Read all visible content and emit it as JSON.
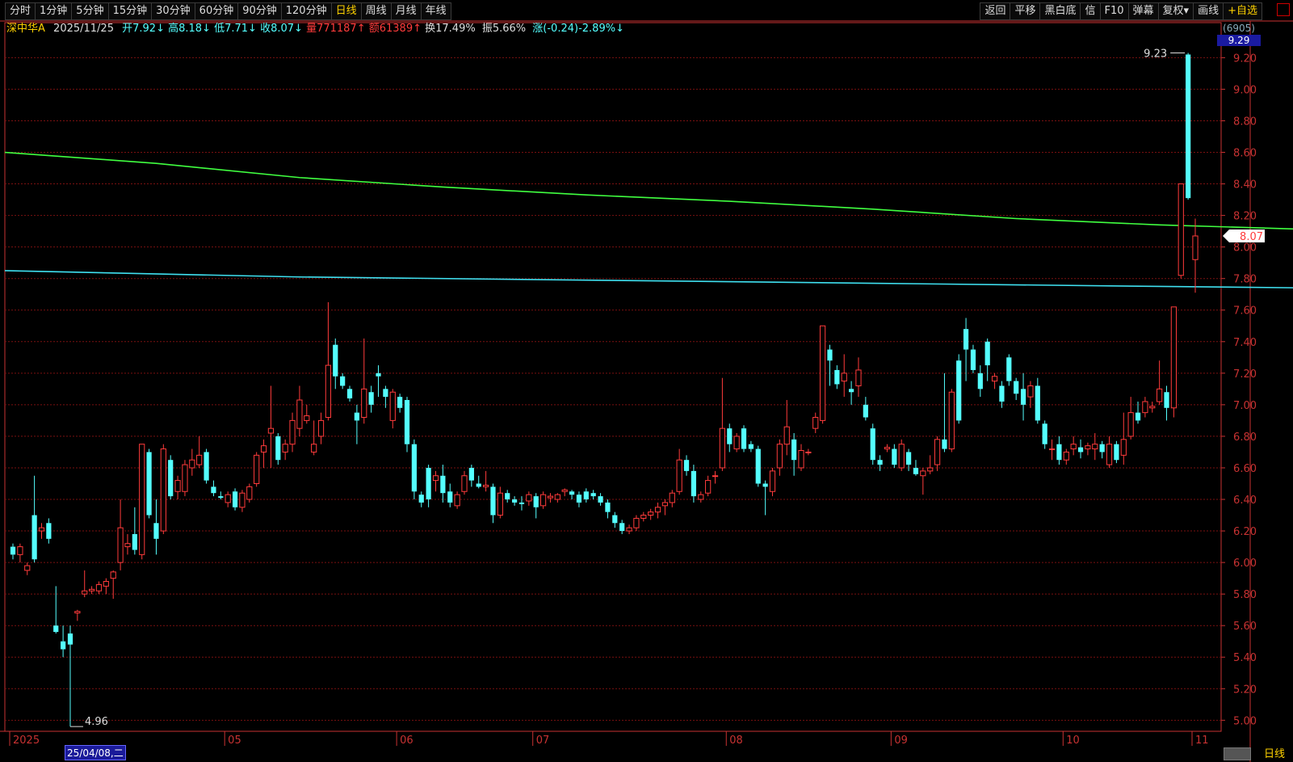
{
  "toolbar": {
    "periods": [
      "分时",
      "1分钟",
      "5分钟",
      "15分钟",
      "30分钟",
      "60分钟",
      "90分钟",
      "120分钟",
      "日线",
      "周线",
      "月线",
      "年线"
    ],
    "active_period": "日线",
    "actions": [
      "返回",
      "平移",
      "黑白底",
      "信",
      "F10",
      "弹幕",
      "复权▾",
      "画线",
      "+自选"
    ]
  },
  "info": {
    "name": "深中华A",
    "date": "2025/11/25",
    "open": "开7.92↓",
    "high": "高8.18↓",
    "low": "低7.71↓",
    "close": "收8.07↓",
    "volume": "量771187↑",
    "amount": "额61389↑",
    "turnover": "换17.49%",
    "amplitude": "振5.66%",
    "change": "涨(-0.24)-2.89%↓"
  },
  "right_badge": {
    "count": "(6905)",
    "max": "9.29"
  },
  "current_price_tag": "8.07",
  "bottom_label": "日线",
  "cursor_date": "25/04/08,二",
  "colors": {
    "up": "#ff3b3b",
    "down": "#54ffff",
    "ma1": "#40ff40",
    "ma2": "#3fe0f0",
    "grid": "#7a1010",
    "axis": "#c83232"
  },
  "chart_data": {
    "type": "candlestick",
    "y_ticks": [
      5.0,
      5.2,
      5.4,
      5.6,
      5.8,
      6.0,
      6.2,
      6.4,
      6.6,
      6.8,
      7.0,
      7.2,
      7.4,
      7.6,
      7.8,
      8.0,
      8.2,
      8.4,
      8.6,
      8.8,
      9.0,
      9.2
    ],
    "ylim": [
      4.93,
      9.33
    ],
    "x_labels": [
      "2025",
      "05",
      "06",
      "07",
      "08",
      "09",
      "10",
      "11"
    ],
    "x_label_index": [
      0,
      30,
      54,
      73,
      100,
      123,
      147,
      165
    ],
    "annotations": {
      "high": "9.23",
      "low": "4.96"
    },
    "ma1": [
      [
        0,
        8.6
      ],
      [
        20,
        8.53
      ],
      [
        40,
        8.44
      ],
      [
        60,
        8.38
      ],
      [
        80,
        8.33
      ],
      [
        100,
        8.29
      ],
      [
        120,
        8.24
      ],
      [
        140,
        8.18
      ],
      [
        160,
        8.14
      ],
      [
        182,
        8.11
      ]
    ],
    "ma2": [
      [
        0,
        7.85
      ],
      [
        40,
        7.81
      ],
      [
        80,
        7.79
      ],
      [
        120,
        7.77
      ],
      [
        160,
        7.75
      ],
      [
        182,
        7.74
      ]
    ],
    "candles": [
      [
        6.1,
        6.12,
        6.02,
        6.05
      ],
      [
        6.05,
        6.12,
        6.0,
        6.1
      ],
      [
        5.95,
        6.0,
        5.92,
        5.98
      ],
      [
        6.3,
        6.55,
        6.0,
        6.02
      ],
      [
        6.2,
        6.25,
        6.15,
        6.22
      ],
      [
        6.25,
        6.28,
        6.12,
        6.15
      ],
      [
        5.6,
        5.85,
        5.55,
        5.56
      ],
      [
        5.5,
        5.6,
        5.4,
        5.45
      ],
      [
        5.55,
        5.6,
        4.96,
        5.48
      ],
      [
        5.68,
        5.7,
        5.63,
        5.69
      ],
      [
        5.8,
        5.95,
        5.78,
        5.82
      ],
      [
        5.82,
        5.85,
        5.8,
        5.83
      ],
      [
        5.82,
        5.88,
        5.8,
        5.86
      ],
      [
        5.85,
        5.9,
        5.8,
        5.88
      ],
      [
        5.9,
        5.95,
        5.77,
        5.94
      ],
      [
        6.0,
        6.4,
        5.95,
        6.22
      ],
      [
        6.1,
        6.18,
        6.05,
        6.12
      ],
      [
        6.18,
        6.35,
        6.05,
        6.08
      ],
      [
        6.05,
        6.75,
        6.02,
        6.75
      ],
      [
        6.7,
        6.72,
        6.28,
        6.3
      ],
      [
        6.25,
        6.4,
        6.05,
        6.15
      ],
      [
        6.2,
        6.75,
        6.18,
        6.72
      ],
      [
        6.65,
        6.68,
        6.4,
        6.42
      ],
      [
        6.45,
        6.55,
        6.4,
        6.52
      ],
      [
        6.45,
        6.65,
        6.42,
        6.62
      ],
      [
        6.6,
        6.72,
        6.55,
        6.65
      ],
      [
        6.62,
        6.8,
        6.6,
        6.68
      ],
      [
        6.7,
        6.72,
        6.5,
        6.52
      ],
      [
        6.48,
        6.52,
        6.42,
        6.44
      ],
      [
        6.42,
        6.45,
        6.4,
        6.41
      ],
      [
        6.38,
        6.45,
        6.35,
        6.43
      ],
      [
        6.45,
        6.47,
        6.33,
        6.35
      ],
      [
        6.35,
        6.46,
        6.32,
        6.44
      ],
      [
        6.4,
        6.5,
        6.38,
        6.48
      ],
      [
        6.5,
        6.7,
        6.48,
        6.68
      ],
      [
        6.7,
        6.78,
        6.6,
        6.74
      ],
      [
        6.82,
        7.12,
        6.6,
        6.85
      ],
      [
        6.8,
        6.82,
        6.62,
        6.65
      ],
      [
        6.7,
        6.78,
        6.65,
        6.75
      ],
      [
        6.75,
        6.95,
        6.7,
        6.9
      ],
      [
        6.85,
        7.12,
        6.8,
        7.03
      ],
      [
        6.9,
        7.0,
        6.88,
        6.93
      ],
      [
        6.7,
        6.9,
        6.68,
        6.75
      ],
      [
        6.8,
        6.95,
        6.75,
        6.9
      ],
      [
        6.92,
        7.65,
        6.9,
        7.25
      ],
      [
        7.38,
        7.42,
        7.1,
        7.18
      ],
      [
        7.18,
        7.2,
        7.1,
        7.12
      ],
      [
        7.1,
        7.12,
        7.02,
        7.04
      ],
      [
        6.95,
        7.0,
        6.75,
        6.9
      ],
      [
        6.92,
        7.42,
        6.88,
        7.1
      ],
      [
        7.08,
        7.12,
        6.95,
        7.0
      ],
      [
        7.2,
        7.25,
        7.05,
        7.18
      ],
      [
        7.1,
        7.12,
        6.98,
        7.05
      ],
      [
        6.9,
        7.1,
        6.85,
        7.08
      ],
      [
        7.05,
        7.07,
        6.95,
        6.98
      ],
      [
        7.03,
        7.05,
        6.7,
        6.75
      ],
      [
        6.75,
        6.78,
        6.4,
        6.45
      ],
      [
        6.43,
        6.45,
        6.35,
        6.38
      ],
      [
        6.6,
        6.62,
        6.35,
        6.4
      ],
      [
        6.52,
        6.58,
        6.45,
        6.55
      ],
      [
        6.55,
        6.62,
        6.38,
        6.44
      ],
      [
        6.45,
        6.5,
        6.35,
        6.38
      ],
      [
        6.36,
        6.45,
        6.34,
        6.43
      ],
      [
        6.45,
        6.58,
        6.43,
        6.55
      ],
      [
        6.6,
        6.62,
        6.48,
        6.52
      ],
      [
        6.5,
        6.55,
        6.47,
        6.48
      ],
      [
        6.48,
        6.58,
        6.45,
        6.49
      ],
      [
        6.48,
        6.5,
        6.25,
        6.3
      ],
      [
        6.3,
        6.48,
        6.28,
        6.44
      ],
      [
        6.44,
        6.46,
        6.38,
        6.4
      ],
      [
        6.4,
        6.42,
        6.36,
        6.38
      ],
      [
        6.38,
        6.42,
        6.33,
        6.37
      ],
      [
        6.39,
        6.45,
        6.36,
        6.43
      ],
      [
        6.42,
        6.44,
        6.28,
        6.35
      ],
      [
        6.36,
        6.45,
        6.34,
        6.43
      ],
      [
        6.41,
        6.44,
        6.38,
        6.42
      ],
      [
        6.4,
        6.44,
        6.38,
        6.43
      ],
      [
        6.45,
        6.47,
        6.42,
        6.46
      ],
      [
        6.45,
        6.46,
        6.4,
        6.43
      ],
      [
        6.43,
        6.45,
        6.35,
        6.38
      ],
      [
        6.45,
        6.47,
        6.38,
        6.4
      ],
      [
        6.44,
        6.46,
        6.4,
        6.42
      ],
      [
        6.42,
        6.44,
        6.36,
        6.38
      ],
      [
        6.38,
        6.4,
        6.28,
        6.32
      ],
      [
        6.3,
        6.32,
        6.22,
        6.25
      ],
      [
        6.25,
        6.27,
        6.18,
        6.2
      ],
      [
        6.2,
        6.24,
        6.18,
        6.22
      ],
      [
        6.22,
        6.3,
        6.2,
        6.28
      ],
      [
        6.28,
        6.32,
        6.26,
        6.3
      ],
      [
        6.3,
        6.34,
        6.27,
        6.32
      ],
      [
        6.32,
        6.38,
        6.28,
        6.35
      ],
      [
        6.36,
        6.4,
        6.3,
        6.38
      ],
      [
        6.38,
        6.46,
        6.35,
        6.44
      ],
      [
        6.45,
        6.72,
        6.43,
        6.65
      ],
      [
        6.65,
        6.68,
        6.55,
        6.58
      ],
      [
        6.58,
        6.62,
        6.38,
        6.42
      ],
      [
        6.4,
        6.45,
        6.38,
        6.43
      ],
      [
        6.44,
        6.55,
        6.42,
        6.52
      ],
      [
        6.55,
        6.58,
        6.5,
        6.55
      ],
      [
        6.6,
        7.17,
        6.58,
        6.85
      ],
      [
        6.85,
        6.88,
        6.7,
        6.75
      ],
      [
        6.72,
        6.82,
        6.7,
        6.8
      ],
      [
        6.85,
        6.87,
        6.7,
        6.72
      ],
      [
        6.75,
        6.77,
        6.7,
        6.72
      ],
      [
        6.72,
        6.74,
        6.48,
        6.5
      ],
      [
        6.5,
        6.52,
        6.3,
        6.48
      ],
      [
        6.45,
        6.6,
        6.42,
        6.58
      ],
      [
        6.6,
        6.78,
        6.55,
        6.75
      ],
      [
        6.75,
        7.03,
        6.68,
        6.86
      ],
      [
        6.78,
        6.82,
        6.55,
        6.65
      ],
      [
        6.6,
        6.75,
        6.58,
        6.71
      ],
      [
        6.7,
        6.72,
        6.68,
        6.7
      ],
      [
        6.85,
        6.95,
        6.82,
        6.92
      ],
      [
        6.9,
        7.5,
        6.88,
        7.5
      ],
      [
        7.35,
        7.38,
        7.12,
        7.28
      ],
      [
        7.22,
        7.25,
        7.1,
        7.13
      ],
      [
        7.15,
        7.32,
        7.05,
        7.2
      ],
      [
        7.1,
        7.15,
        7.0,
        7.08
      ],
      [
        7.12,
        7.3,
        7.05,
        7.22
      ],
      [
        7.0,
        7.05,
        6.9,
        6.92
      ],
      [
        6.85,
        6.88,
        6.62,
        6.65
      ],
      [
        6.65,
        6.68,
        6.58,
        6.62
      ],
      [
        6.72,
        6.75,
        6.7,
        6.73
      ],
      [
        6.72,
        6.75,
        6.6,
        6.62
      ],
      [
        6.6,
        6.78,
        6.58,
        6.75
      ],
      [
        6.7,
        6.72,
        6.58,
        6.62
      ],
      [
        6.6,
        6.65,
        6.55,
        6.56
      ],
      [
        6.55,
        6.6,
        6.43,
        6.58
      ],
      [
        6.58,
        6.68,
        6.56,
        6.6
      ],
      [
        6.62,
        6.8,
        6.58,
        6.78
      ],
      [
        6.78,
        7.2,
        6.7,
        6.72
      ],
      [
        6.72,
        7.1,
        6.7,
        7.08
      ],
      [
        7.28,
        7.32,
        6.88,
        6.9
      ],
      [
        7.48,
        7.55,
        7.15,
        7.35
      ],
      [
        7.35,
        7.38,
        7.2,
        7.22
      ],
      [
        7.2,
        7.25,
        7.05,
        7.1
      ],
      [
        7.4,
        7.42,
        7.15,
        7.25
      ],
      [
        7.15,
        7.2,
        7.1,
        7.18
      ],
      [
        7.12,
        7.15,
        6.98,
        7.02
      ],
      [
        7.3,
        7.32,
        7.12,
        7.15
      ],
      [
        7.15,
        7.17,
        7.03,
        7.07
      ],
      [
        7.1,
        7.2,
        6.9,
        7.0
      ],
      [
        7.05,
        7.15,
        6.98,
        7.12
      ],
      [
        7.12,
        7.17,
        6.88,
        6.9
      ],
      [
        6.88,
        6.9,
        6.72,
        6.75
      ],
      [
        6.72,
        6.78,
        6.65,
        6.72
      ],
      [
        6.75,
        6.8,
        6.62,
        6.65
      ],
      [
        6.65,
        6.72,
        6.62,
        6.7
      ],
      [
        6.72,
        6.8,
        6.68,
        6.75
      ],
      [
        6.73,
        6.78,
        6.66,
        6.7
      ],
      [
        6.72,
        6.76,
        6.68,
        6.74
      ],
      [
        6.72,
        6.82,
        6.65,
        6.75
      ],
      [
        6.75,
        6.77,
        6.66,
        6.7
      ],
      [
        6.62,
        6.8,
        6.6,
        6.75
      ],
      [
        6.75,
        6.77,
        6.63,
        6.65
      ],
      [
        6.68,
        6.95,
        6.62,
        6.78
      ],
      [
        6.8,
        7.05,
        6.78,
        6.95
      ],
      [
        6.95,
        7.02,
        6.88,
        6.9
      ],
      [
        6.95,
        7.05,
        6.92,
        7.02
      ],
      [
        6.98,
        7.02,
        6.95,
        6.99
      ],
      [
        7.02,
        7.28,
        7.0,
        7.1
      ],
      [
        7.08,
        7.12,
        6.9,
        6.98
      ],
      [
        6.98,
        7.62,
        6.92,
        7.62
      ],
      [
        7.82,
        8.4,
        7.8,
        8.4
      ],
      [
        9.22,
        9.23,
        8.3,
        8.31
      ],
      [
        7.92,
        8.18,
        7.71,
        8.07
      ]
    ]
  }
}
